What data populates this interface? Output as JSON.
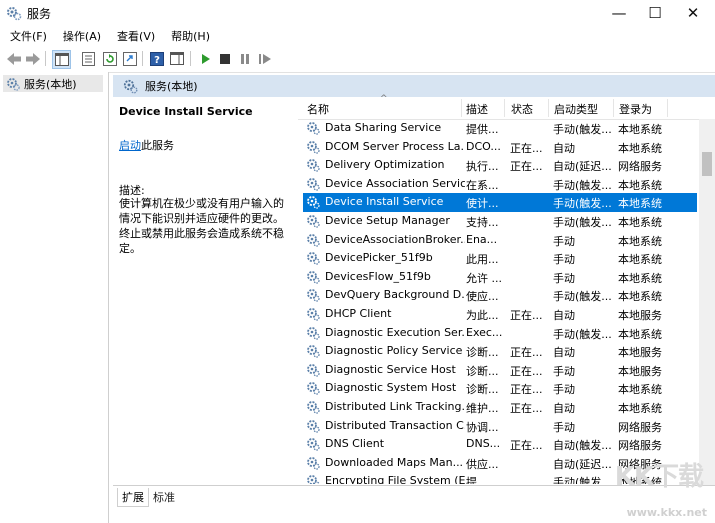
{
  "window": {
    "title": "服务",
    "min_label": "—",
    "max_label": "☐",
    "close_label": "✕"
  },
  "menu": [
    "文件(F)",
    "操作(A)",
    "查看(V)",
    "帮助(H)"
  ],
  "tree": {
    "item": "服务(本地)"
  },
  "panel": {
    "header": "服务(本地)"
  },
  "detail": {
    "service_name": "Device Install Service",
    "start_link": "启动",
    "start_suffix": "此服务",
    "desc_label": "描述:",
    "desc_text": "使计算机在极少或没有用户输入的情况下能识别并适应硬件的更改。终止或禁用此服务会造成系统不稳定。"
  },
  "columns": [
    "名称",
    "描述",
    "状态",
    "启动类型",
    "登录为"
  ],
  "rows": [
    [
      "Data Sharing Service",
      "提供...",
      "",
      "手动(触发...",
      "本地系统"
    ],
    [
      "DCOM Server Process La...",
      "DCO...",
      "正在...",
      "自动",
      "本地系统"
    ],
    [
      "Delivery Optimization",
      "执行...",
      "正在...",
      "自动(延迟...",
      "网络服务"
    ],
    [
      "Device Association Service",
      "在系...",
      "",
      "手动(触发...",
      "本地系统"
    ],
    [
      "Device Install Service",
      "使计...",
      "",
      "手动(触发...",
      "本地系统"
    ],
    [
      "Device Setup Manager",
      "支持...",
      "",
      "手动(触发...",
      "本地系统"
    ],
    [
      "DeviceAssociationBroker...",
      "Ena...",
      "",
      "手动",
      "本地系统"
    ],
    [
      "DevicePicker_51f9b",
      "此用...",
      "",
      "手动",
      "本地系统"
    ],
    [
      "DevicesFlow_51f9b",
      "允许 ...",
      "",
      "手动",
      "本地系统"
    ],
    [
      "DevQuery Background D...",
      "使应...",
      "",
      "手动(触发...",
      "本地系统"
    ],
    [
      "DHCP Client",
      "为此...",
      "正在...",
      "自动",
      "本地服务"
    ],
    [
      "Diagnostic Execution Ser...",
      "Exec...",
      "",
      "手动(触发...",
      "本地系统"
    ],
    [
      "Diagnostic Policy Service",
      "诊断...",
      "正在...",
      "自动",
      "本地服务"
    ],
    [
      "Diagnostic Service Host",
      "诊断...",
      "正在...",
      "手动",
      "本地服务"
    ],
    [
      "Diagnostic System Host",
      "诊断...",
      "正在...",
      "手动",
      "本地系统"
    ],
    [
      "Distributed Link Tracking...",
      "维护...",
      "正在...",
      "自动",
      "本地系统"
    ],
    [
      "Distributed Transaction C...",
      "协调...",
      "",
      "手动",
      "网络服务"
    ],
    [
      "DNS Client",
      "DNS...",
      "正在...",
      "自动(触发...",
      "网络服务"
    ],
    [
      "Downloaded Maps Man...",
      "供应...",
      "",
      "自动(延迟...",
      "网络服务"
    ],
    [
      "Encrypting File System (E...",
      "提...",
      "",
      "手动(触发...",
      "本地系统"
    ]
  ],
  "selected_index": 4,
  "tabs": [
    "扩展",
    "标准"
  ],
  "watermark": {
    "logo": "KK下载",
    "url": "www.kkx.net"
  },
  "colors": {
    "selection": "#0078d7",
    "link": "#0066cc",
    "header_band": "#d7e4f2"
  }
}
